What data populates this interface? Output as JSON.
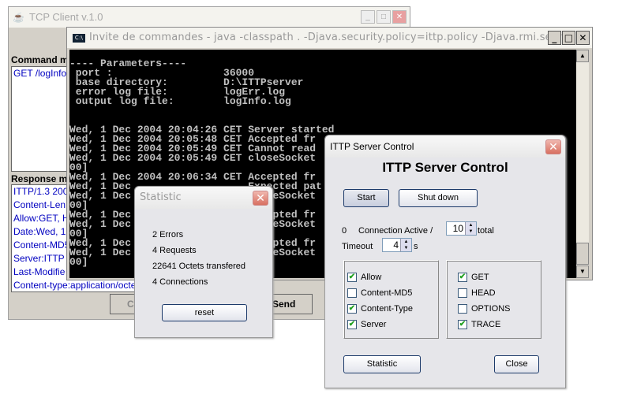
{
  "tcp_client": {
    "title": "TCP Client v.1.0",
    "command_label": "Command m",
    "commands": [
      "GET /logInfo"
    ],
    "response_label": "Response m",
    "responses": [
      "ITTP/1.3 200",
      "Content-Len",
      "Allow:GET, H",
      "Date:Wed, 1",
      "Content-MD5",
      "Server:ITTP :",
      "Last-Modifie",
      "Content-type:application/octe"
    ],
    "connect_label": "Co",
    "send_label": "Send"
  },
  "console": {
    "title": "Invite de commandes - java -classpath . -Djava.security.policy=ittp.policy -Djava.rmi.serve...",
    "lines": [
      "",
      "---- Parameters----",
      " port :                  36000",
      " base directory:         D:\\ITTPserver",
      " error log file:         logErr.log",
      " output log file:        logInfo.log",
      "",
      "",
      "Wed, 1 Dec 2004 20:04:26 CET Server started",
      "Wed, 1 Dec 2004 20:05:48 CET Accepted fr",
      "Wed, 1 Dec 2004 20:05:49 CET Cannot read",
      "Wed, 1 Dec 2004 20:05:49 CET closeSocket                                   50",
      "00]",
      "Wed, 1 Dec 2004 20:06:34 CET Accepted fr",
      "Wed, 1 Dec                   Expected pat",
      "Wed, 1 Dec                   closeSocket                                   50",
      "00]",
      "Wed, 1 Dec                   Accepted fr",
      "Wed, 1 Dec                   closeSocket                                   50",
      "00]",
      "Wed, 1 Dec                   Accepted fr",
      "Wed, 1 Dec                   closeSocket                                   50",
      "00]"
    ]
  },
  "statistic": {
    "title": "Statistic",
    "errors": "2 Errors",
    "requests": "4 Requests",
    "octets": "22641 Octets transfered",
    "connections": "4 Connections",
    "reset_label": "reset"
  },
  "server_control": {
    "title": "ITTP Server Control",
    "heading": "ITTP Server Control",
    "start_label": "Start",
    "shutdown_label": "Shut down",
    "active_count": "0",
    "connection_active_label": "Connection Active /",
    "total_value": "10",
    "total_label": "total",
    "timeout_label": "Timeout",
    "timeout_value": "4",
    "timeout_unit": "s",
    "headers": [
      {
        "label": "Allow",
        "checked": true
      },
      {
        "label": "Content-MD5",
        "checked": false
      },
      {
        "label": "Content-Type",
        "checked": true
      },
      {
        "label": "Server",
        "checked": true
      }
    ],
    "methods": [
      {
        "label": "GET",
        "checked": true
      },
      {
        "label": "HEAD",
        "checked": false
      },
      {
        "label": "OPTIONS",
        "checked": false
      },
      {
        "label": "TRACE",
        "checked": true
      }
    ],
    "statistic_label": "Statistic",
    "close_label": "Close"
  }
}
